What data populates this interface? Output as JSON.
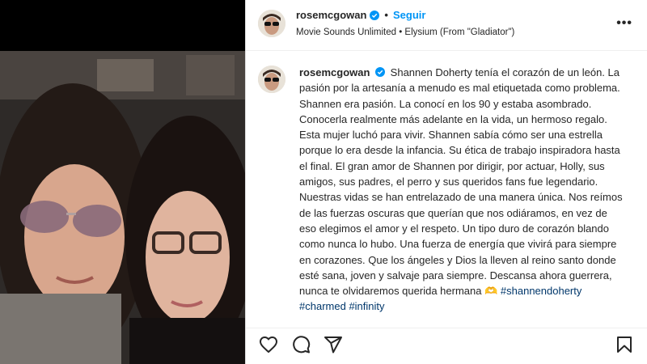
{
  "post": {
    "username": "rosemcgowan",
    "follow_label": "Seguir",
    "audio": "Movie Sounds Unlimited • Elysium (From \"Gladiator\")",
    "more_icon": "more-horizontal-icon"
  },
  "caption": {
    "username": "rosemcgowan",
    "text": "Shannen Doherty tenía el corazón de un león. La pasión por la artesanía a menudo es mal etiquetada como problema. Shannen era pasión. La conocí en los 90 y estaba asombrado. Conocerla realmente más adelante en la vida, un hermoso regalo. Esta mujer luchó para vivir. Shannen sabía cómo ser una estrella porque lo era desde la infancia. Su ética de trabajo inspiradora hasta el final. El gran amor de Shannen por dirigir, por actuar, Holly, sus amigos, sus padres, el perro y sus queridos fans fue legendario. Nuestras vidas se han entrelazado de una manera única. Nos reímos de las fuerzas oscuras que querían que nos odiáramos, en vez de eso elegimos el amor y el respeto. Un tipo duro de corazón blando como nunca lo hubo. Una fuerza de energía que vivirá para siempre en corazones. Que los ángeles y Dios la lleven al reino santo donde esté sana, joven y salvaje para siempre. Descansa ahora guerrera, nunca te olvidaremos querida hermana",
    "emoji": "🫶",
    "hashtags": [
      "#shannendoherty",
      "#charmed",
      "#infinity"
    ]
  },
  "actions": {
    "like_icon": "heart-icon",
    "comment_icon": "comment-icon",
    "share_icon": "share-icon",
    "save_icon": "bookmark-icon"
  },
  "colors": {
    "link": "#0095f6",
    "hashtag": "#00376b",
    "verified": "#0095f6"
  }
}
